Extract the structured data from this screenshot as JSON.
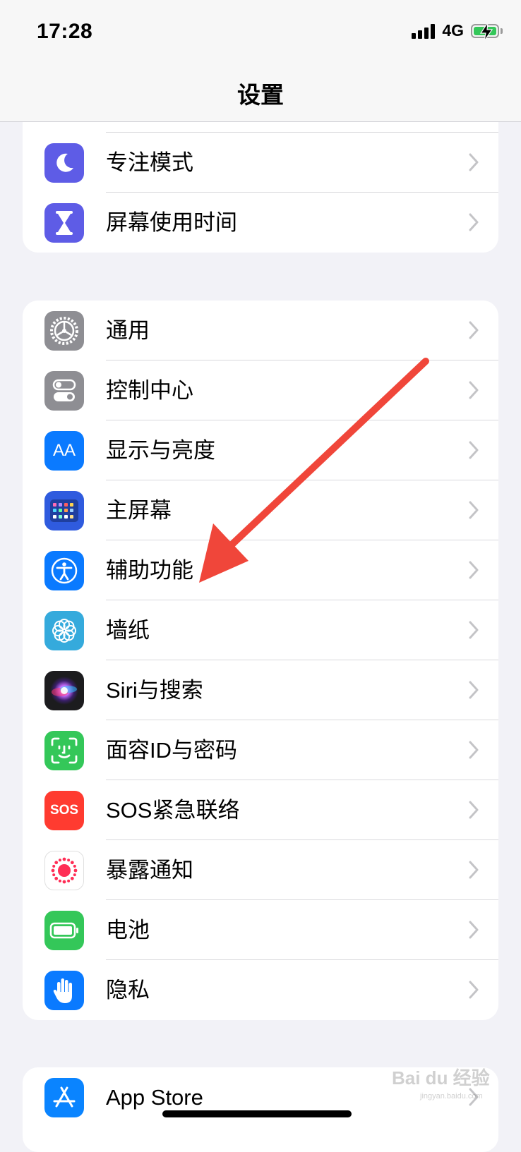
{
  "status_bar": {
    "time": "17:28",
    "network": "4G"
  },
  "nav": {
    "title": "设置"
  },
  "group1": [
    {
      "label": "专注模式",
      "icon": "moon-icon",
      "color": "#5E5CE6"
    },
    {
      "label": "屏幕使用时间",
      "icon": "hourglass-icon",
      "color": "#5E5CE6"
    }
  ],
  "group2": [
    {
      "label": "通用",
      "icon": "gear-icon",
      "color": "#8E8E93"
    },
    {
      "label": "控制中心",
      "icon": "toggles-icon",
      "color": "#8E8E93"
    },
    {
      "label": "显示与亮度",
      "icon": "text-size-icon",
      "color": "#0A7AFF",
      "icon_text": "AA"
    },
    {
      "label": "主屏幕",
      "icon": "home-grid-icon",
      "color": "#2F5BDE"
    },
    {
      "label": "辅助功能",
      "icon": "accessibility-icon",
      "color": "#0A7AFF"
    },
    {
      "label": "墙纸",
      "icon": "flower-icon",
      "color": "#35AADC"
    },
    {
      "label": "Siri与搜索",
      "icon": "siri-icon",
      "color": "#1C1C1E"
    },
    {
      "label": "面容ID与密码",
      "icon": "face-id-icon",
      "color": "#34C759"
    },
    {
      "label": "SOS紧急联络",
      "icon": "sos-icon",
      "color": "#FF3B30",
      "icon_text": "SOS"
    },
    {
      "label": "暴露通知",
      "icon": "exposure-icon",
      "color": "#FFFFFF"
    },
    {
      "label": "电池",
      "icon": "battery-icon",
      "color": "#34C759"
    },
    {
      "label": "隐私",
      "icon": "hand-icon",
      "color": "#0A7AFF"
    }
  ],
  "group3": [
    {
      "label": "App Store",
      "icon": "app-store-icon",
      "color": "#0A84FF"
    }
  ],
  "watermark": {
    "text": "Bai du 经验",
    "sub": "jingyan.baidu.com"
  },
  "colors": {
    "background": "#F2F2F7",
    "arrow": "#F0463A",
    "chevron": "#C4C4C7"
  }
}
